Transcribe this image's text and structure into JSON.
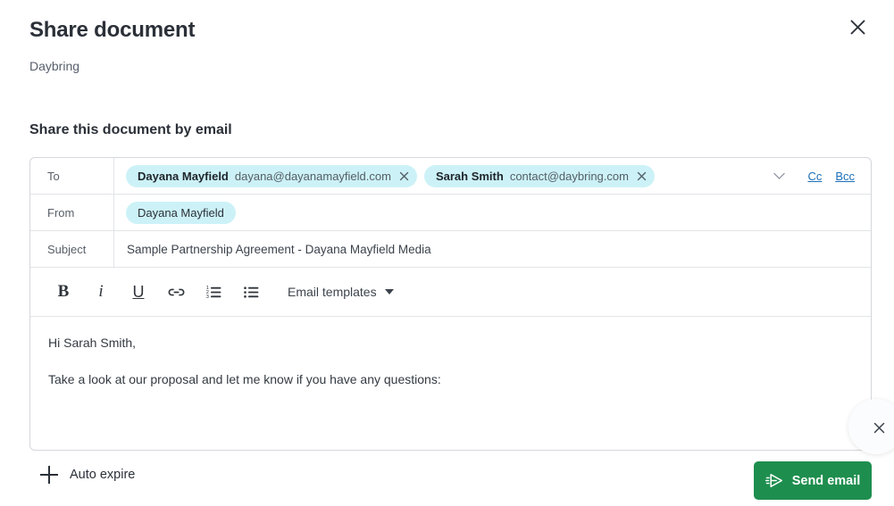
{
  "dialog": {
    "title": "Share document",
    "subtitle": "Daybring",
    "close_icon": "close-icon"
  },
  "section": {
    "heading": "Share this document by email"
  },
  "form": {
    "to": {
      "label": "To",
      "recipients": [
        {
          "name": "Dayana Mayfield",
          "email": "dayana@dayanamayfield.com",
          "remove_icon": "close-icon"
        },
        {
          "name": "Sarah Smith",
          "email": "contact@daybring.com",
          "remove_icon": "close-icon"
        }
      ],
      "expand_icon": "chevron-down-icon",
      "cc_label": "Cc",
      "bcc_label": "Bcc"
    },
    "from": {
      "label": "From",
      "value": "Dayana Mayfield"
    },
    "subject": {
      "label": "Subject",
      "value": "Sample Partnership Agreement - Dayana Mayfield Media"
    },
    "toolbar": {
      "bold": "B",
      "italic": "i",
      "underline": "U",
      "link_icon": "link-icon",
      "ordered_list_icon": "numbered-list-icon",
      "bullet_list_icon": "bullet-list-icon",
      "templates_label": "Email templates",
      "templates_caret_icon": "caret-down-icon"
    },
    "body": {
      "greeting": "Hi Sarah Smith,",
      "paragraph": "Take a look at our proposal and let me know if you have any questions:"
    }
  },
  "footer": {
    "auto_expire_label": "Auto expire",
    "auto_expire_icon": "plus-icon",
    "send_label": "Send email",
    "send_icon": "send-icon"
  },
  "widget": {
    "close_icon": "close-icon"
  },
  "colors": {
    "accent_green": "#1e8e4e",
    "chip_bg": "#ccf2f7",
    "link_blue": "#1c6fb8",
    "text_dark": "#2b3038",
    "border": "#d4d7dc"
  }
}
